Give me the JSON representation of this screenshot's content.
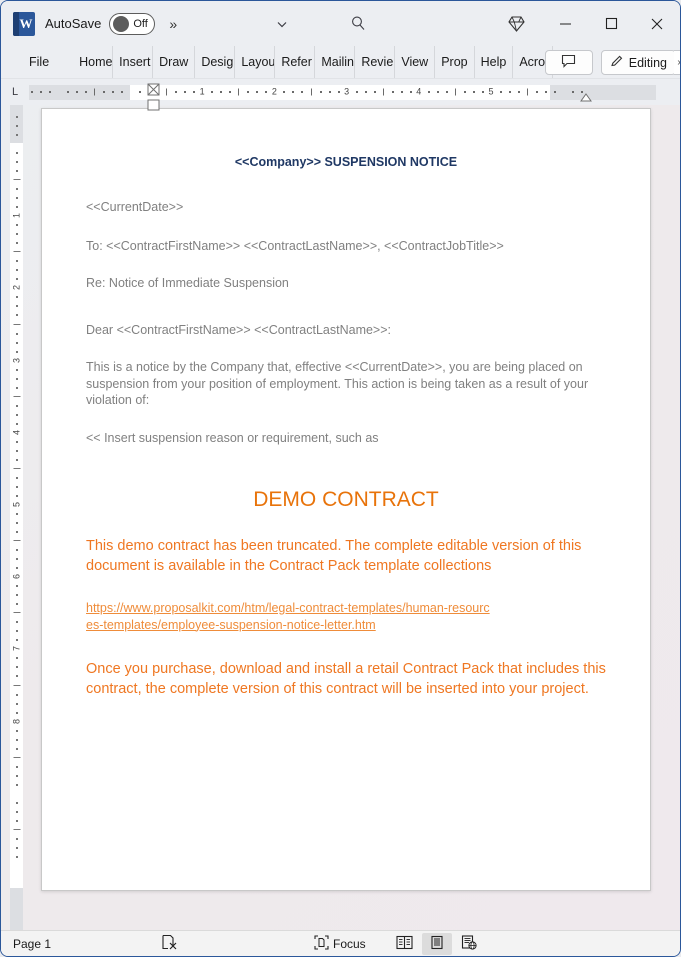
{
  "titlebar": {
    "app_logo_letter": "W",
    "autosave_label": "AutoSave",
    "autosave_state": "Off",
    "overflow_chevrons": "»",
    "icons": {
      "customize_quick_access": "chevron-down-icon",
      "search": "search-icon",
      "diamond": "diamond-icon",
      "minimize": "minimize-icon",
      "maximize": "maximize-icon",
      "close": "close-icon"
    }
  },
  "ribbon": {
    "tabs": [
      {
        "label": "File",
        "full": "File"
      },
      {
        "label": "Home",
        "full": "Home"
      },
      {
        "label": "Insert",
        "full": "Insert"
      },
      {
        "label": "Draw",
        "full": "Draw"
      },
      {
        "label": "Design",
        "full": "Design"
      },
      {
        "label": "Layout",
        "full": "Layout"
      },
      {
        "label": "Refer",
        "full": "References"
      },
      {
        "label": "Mailin",
        "full": "Mailings"
      },
      {
        "label": "Revie",
        "full": "Review"
      },
      {
        "label": "View",
        "full": "View"
      },
      {
        "label": "Prop",
        "full": "Properties"
      },
      {
        "label": "Help",
        "full": "Help"
      },
      {
        "label": "Acrob",
        "full": "Acrobat"
      }
    ],
    "comment_button": "comment-icon",
    "editing_button": "Editing",
    "editing_caret": "›"
  },
  "ruler": {
    "horizontal_numbers": [
      "1",
      "2",
      "3",
      "4",
      "5"
    ],
    "vertical_numbers": [
      "1",
      "2",
      "3",
      "4",
      "5",
      "6",
      "7",
      "8"
    ],
    "corner_tab_stop": "L"
  },
  "document": {
    "title": "<<Company>> SUSPENSION NOTICE",
    "paragraphs": [
      "<<CurrentDate>>",
      "To: <<ContractFirstName>> <<ContractLastName>>, <<ContractJobTitle>>",
      "Re: Notice of Immediate Suspension",
      "Dear <<ContractFirstName>> <<ContractLastName>>:",
      "This is a notice by the Company that, effective <<CurrentDate>>, you are being placed on suspension from your position of employment. This action is being taken as a result of your violation of:",
      "<< Insert suspension reason or requirement, such as"
    ],
    "demo": {
      "heading": "DEMO CONTRACT",
      "paragraph_1": "This demo contract has been truncated. The complete editable version of this document is available in the Contract Pack template collections",
      "link": "https://www.proposalkit.com/htm/legal-contract-templates/human-resources-templates/employee-suspension-notice-letter.htm",
      "paragraph_2": "Once you purchase, download and install a retail Contract Pack that includes this contract, the complete version of this contract will be inserted into your project."
    }
  },
  "statusbar": {
    "page_label": "Page 1",
    "proofing_icon": "proofing-errors-icon",
    "focus_label": "Focus",
    "focus_icon": "focus-icon",
    "view_read_mode": "read-mode-icon",
    "view_print_layout": "print-layout-icon",
    "view_web_layout": "web-layout-icon"
  },
  "colors": {
    "word_blue": "#2b579a",
    "doc_title_navy": "#1f3864",
    "body_gray": "#808080",
    "demo_orange": "#ef7722",
    "demo_heading_orange": "#e8730a",
    "link_orange": "#ef8c3a"
  }
}
